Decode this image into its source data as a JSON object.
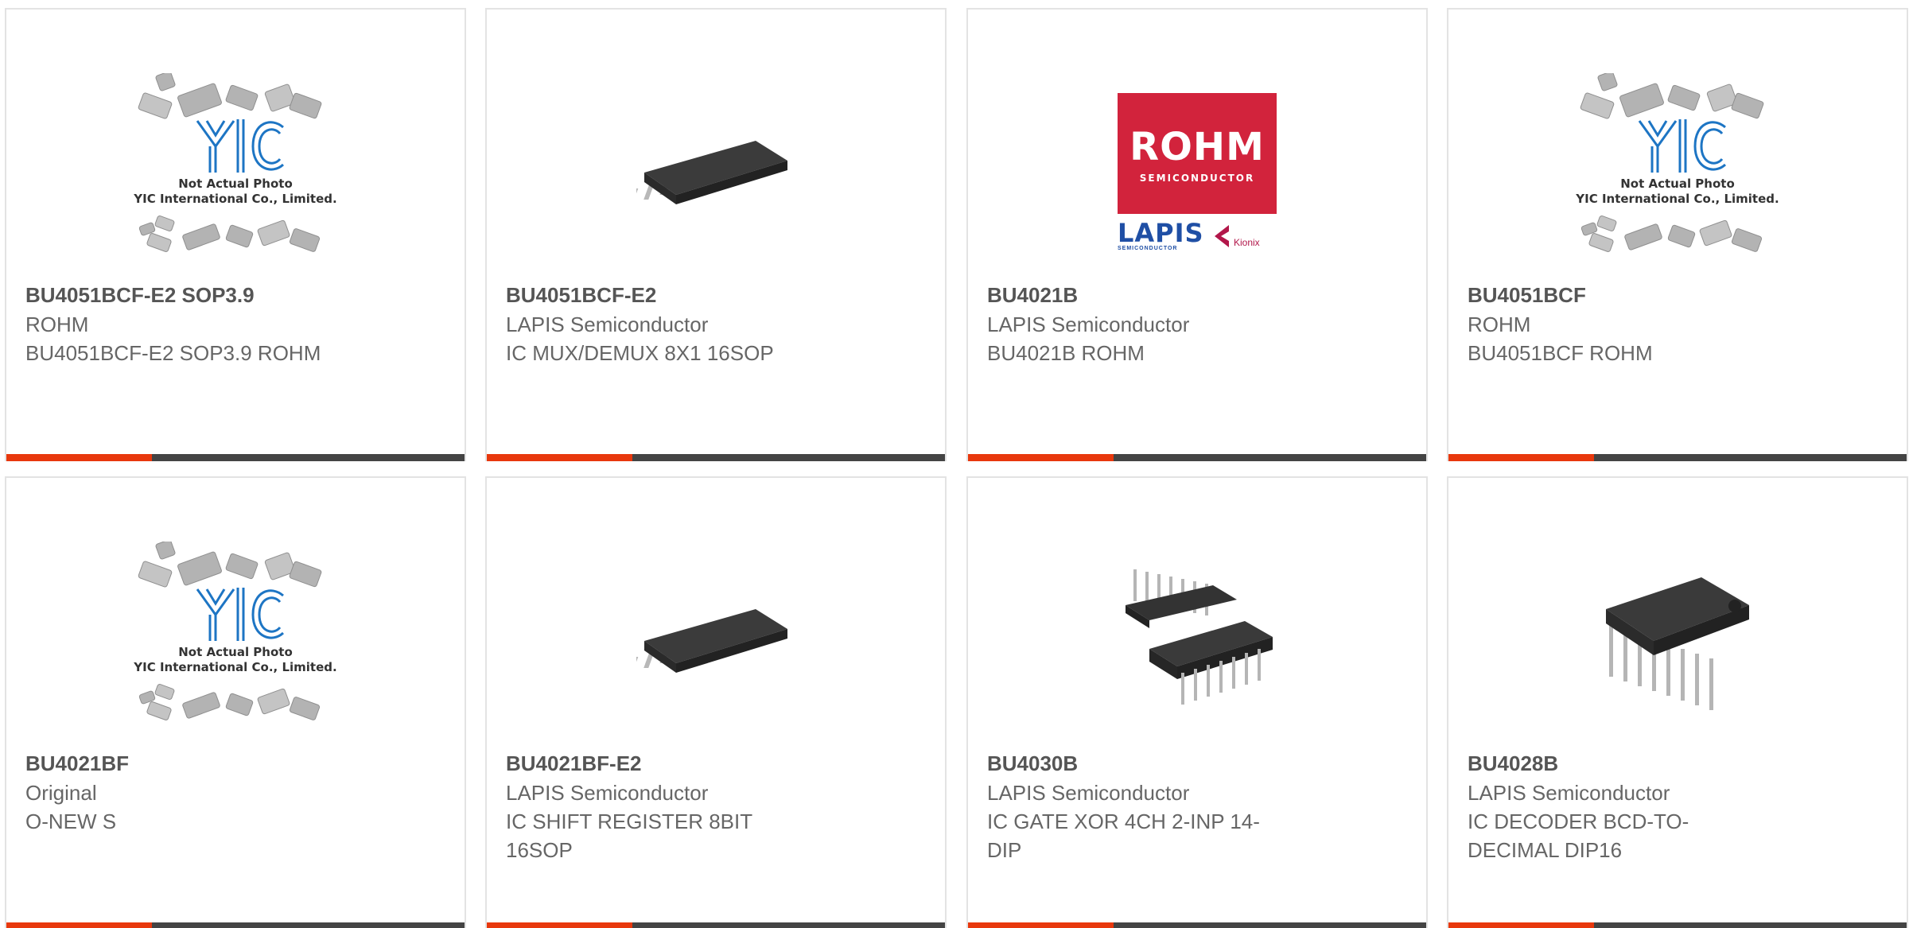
{
  "colors": {
    "accent": "#e8380d",
    "bar": "#444444",
    "border": "#e3e3e3"
  },
  "products": [
    {
      "title": "BU4051BCF-E2 SOP3.9",
      "brand": "ROHM",
      "desc": "BU4051BCF-E2 SOP3.9 ROHM",
      "image": "placeholder"
    },
    {
      "title": "BU4051BCF-E2",
      "brand": "LAPIS Semiconductor",
      "desc": "IC MUX/DEMUX 8X1 16SOP",
      "image": "sop-chip"
    },
    {
      "title": "BU4021B",
      "brand": "LAPIS Semiconductor",
      "desc": "BU4021B ROHM",
      "image": "rohm-logo"
    },
    {
      "title": "BU4051BCF",
      "brand": "ROHM",
      "desc": "BU4051BCF ROHM",
      "image": "placeholder"
    },
    {
      "title": "BU4021BF",
      "brand": "Original",
      "desc": "O-NEW S",
      "image": "placeholder"
    },
    {
      "title": "BU4021BF-E2",
      "brand": "LAPIS Semiconductor",
      "desc": "IC SHIFT REGISTER 8BIT 16SOP",
      "image": "sop-chip"
    },
    {
      "title": "BU4030B",
      "brand": "LAPIS Semiconductor",
      "desc": "IC GATE XOR 4CH 2-INP 14-DIP",
      "image": "dip-pair"
    },
    {
      "title": "BU4028B",
      "brand": "LAPIS Semiconductor",
      "desc": "IC DECODER BCD-TO-DECIMAL DIP16",
      "image": "dip-chip"
    }
  ],
  "placeholder": {
    "logo_text": "YIC",
    "note_line1": "Not Actual Photo",
    "note_line2": "YIC International Co., Limited."
  },
  "rohm_logo": {
    "main": "ROHM",
    "sub": "SEMICONDUCTOR",
    "lapis": "LAPIS",
    "lapis_sub": "SEMICONDUCTOR",
    "kionix": "Kionix"
  }
}
